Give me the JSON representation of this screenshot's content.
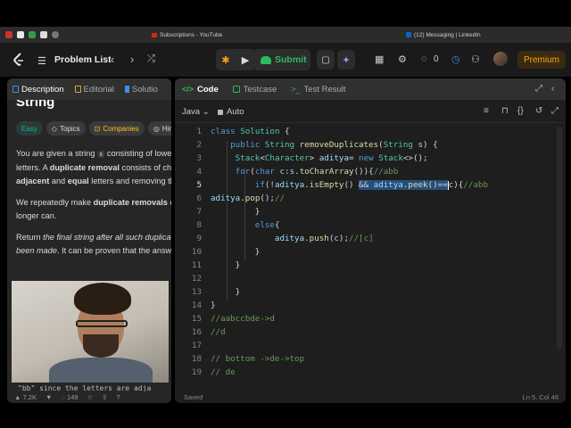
{
  "browser": {
    "tab1_title": "Subscriptions - YouTube",
    "tab2_title": "(12) Messaging | LinkedIn"
  },
  "nav": {
    "problem_list": "Problem List",
    "submit": "Submit",
    "fire_count": "0",
    "premium": "Premium"
  },
  "left": {
    "tabs": [
      "Description",
      "Editorial",
      "Solutio"
    ],
    "title": "String",
    "chips": [
      "Easy",
      "Topics",
      "Companies",
      "Hint"
    ],
    "para1_a": "You are given a string ",
    "para1_code": "s",
    "para1_b": " consisting of lowerca",
    "para1_c": "letters. A ",
    "para1_bold1": "duplicate removal",
    "para1_d": " consists of cho",
    "para1_bold2": "adjacent",
    "para1_e": " and ",
    "para1_bold3": "equal",
    "para1_f": " letters and removing the",
    "para2_a": "We repeatedly make ",
    "para2_bold": "duplicate removals",
    "para2_b": " or",
    "para2_c": "longer can.",
    "para3_a": "Return ",
    "para3_italic": "the final string after all such duplicate",
    "para3_italic2": "been made",
    "para3_b": ". It can be proven that the answer",
    "overlay_line": "\"bb\" since the letters are adja",
    "footer": [
      "7.2K",
      "149"
    ]
  },
  "code": {
    "tabs": [
      "Code",
      "Testcase",
      "Test Result"
    ],
    "language": "Java",
    "mode": "Auto",
    "status_left": "Saved",
    "status_right": "Ln 5, Col 46",
    "lines": [
      {
        "n": "1",
        "t": "class Solution {"
      },
      {
        "n": "2",
        "t": "    public String removeDuplicates(String s) {"
      },
      {
        "n": "3",
        "t": "    Stack<Character> aditya= new Stack<>();"
      },
      {
        "n": "4",
        "t": "    for(char c:s.toCharArray()){//abb"
      },
      {
        "n": "5",
        "t": "        if(!aditya.isEmpty() && aditya.peek()==c){//abb"
      },
      {
        "n": "6",
        "t": "aditya.pop();//"
      },
      {
        "n": "7",
        "t": "        }"
      },
      {
        "n": "8",
        "t": "        else{"
      },
      {
        "n": "9",
        "t": "            aditya.push(c);//[c]"
      },
      {
        "n": "10",
        "t": "        }"
      },
      {
        "n": "11",
        "t": "    }"
      },
      {
        "n": "12",
        "t": ""
      },
      {
        "n": "13",
        "t": "    }"
      },
      {
        "n": "14",
        "t": "}"
      },
      {
        "n": "15",
        "t": "//aabccbde->d"
      },
      {
        "n": "16",
        "t": "//d"
      },
      {
        "n": "17",
        "t": ""
      },
      {
        "n": "18",
        "t": "// bottom ->de->top"
      },
      {
        "n": "19",
        "t": "// de"
      }
    ]
  }
}
